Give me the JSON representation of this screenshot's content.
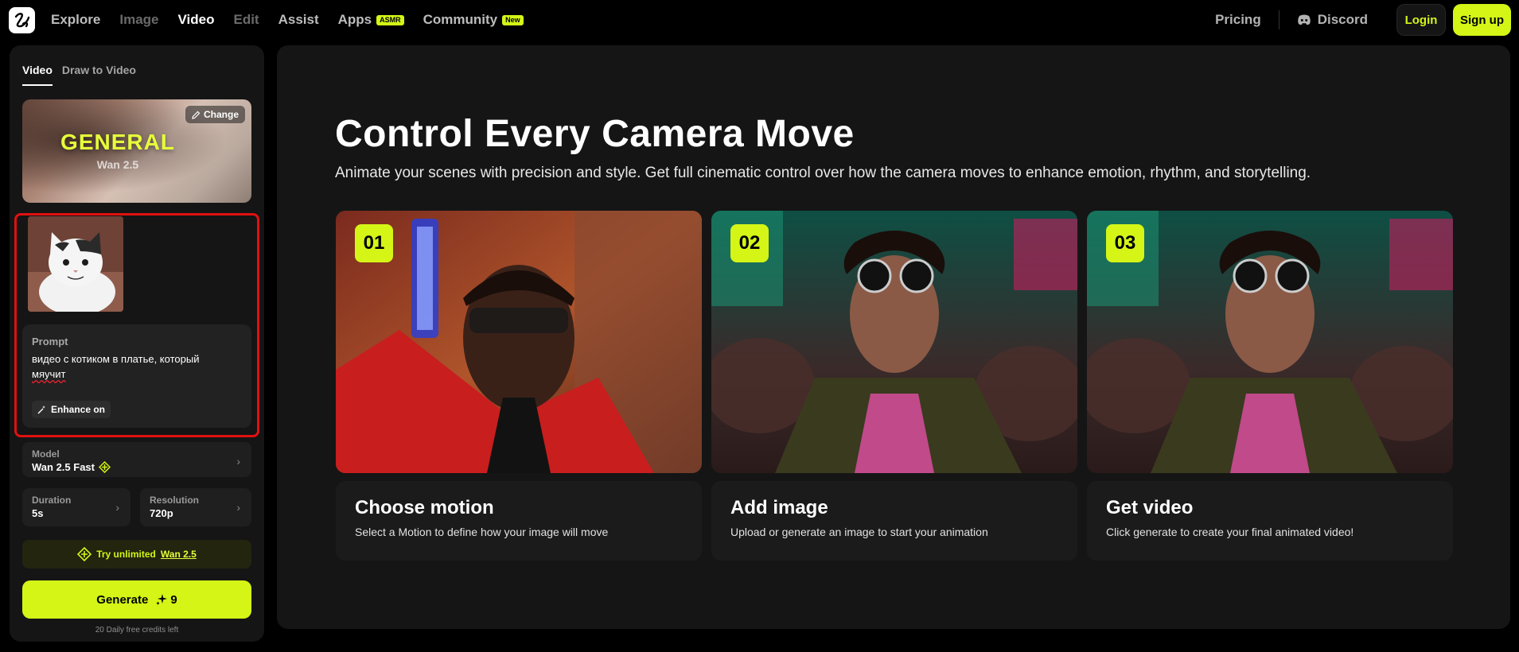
{
  "nav": {
    "items": [
      {
        "label": "Explore",
        "style": "bright"
      },
      {
        "label": "Image",
        "style": "muted"
      },
      {
        "label": "Video",
        "style": "active"
      },
      {
        "label": "Edit",
        "style": "muted"
      },
      {
        "label": "Assist",
        "style": "bright"
      },
      {
        "label": "Apps",
        "style": "bright",
        "badge": "ASMR"
      },
      {
        "label": "Community",
        "style": "bright",
        "badge": "New"
      }
    ],
    "pricing": "Pricing",
    "discord": "Discord",
    "login": "Login",
    "signup": "Sign up"
  },
  "panel": {
    "tabs": [
      "Video",
      "Draw to Video"
    ],
    "model_card": {
      "title": "GENERAL",
      "subtitle": "Wan 2.5",
      "change_label": "Change"
    },
    "prompt": {
      "label": "Prompt",
      "text_line1": "видео с котиком в платье, который",
      "text_line2": "мяучит",
      "enhance_label": "Enhance on"
    },
    "model": {
      "label": "Model",
      "value": "Wan 2.5 Fast"
    },
    "duration": {
      "label": "Duration",
      "value": "5s"
    },
    "resolution": {
      "label": "Resolution",
      "value": "720p"
    },
    "unlimited": {
      "prefix": "Try unlimited",
      "link": "Wan 2.5"
    },
    "generate": {
      "label": "Generate",
      "cost": "9"
    },
    "credits": "20 Daily free credits left"
  },
  "main": {
    "heading": "Control Every Camera Move",
    "subheading": "Animate your scenes with precision and style. Get full cinematic control over how the camera moves to enhance emotion, rhythm, and storytelling.",
    "steps": [
      {
        "num": "01",
        "title": "Choose motion",
        "desc": "Select a Motion to define how your image will move"
      },
      {
        "num": "02",
        "title": "Add image",
        "desc": "Upload or generate an image to start your animation"
      },
      {
        "num": "03",
        "title": "Get video",
        "desc": "Click generate to create your final animated video!"
      }
    ]
  },
  "colors": {
    "accent": "#d4f516",
    "panel": "#151515",
    "highlight": "#e11010"
  }
}
